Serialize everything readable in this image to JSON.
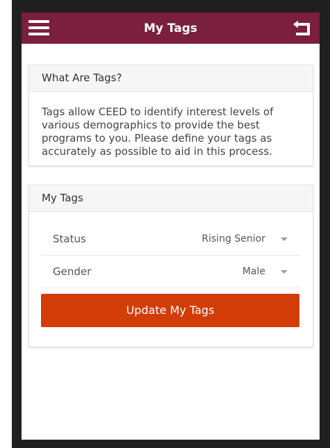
{
  "header": {
    "title": "My Tags",
    "menu_icon": "hamburger-menu-icon",
    "back_icon": "return-arrow-icon",
    "background_color": "#7a1f3e"
  },
  "info_card": {
    "title": "What Are Tags?",
    "body": "Tags allow CEED to identify interest levels of various demographics to provide the best programs to you. Please define your tags as accurately as possible to aid in this process."
  },
  "tags_card": {
    "title": "My Tags",
    "rows": [
      {
        "label": "Status",
        "value": "Rising Senior"
      },
      {
        "label": "Gender",
        "value": "Male"
      }
    ],
    "button_label": "Update My Tags",
    "button_color": "#d23c07"
  }
}
